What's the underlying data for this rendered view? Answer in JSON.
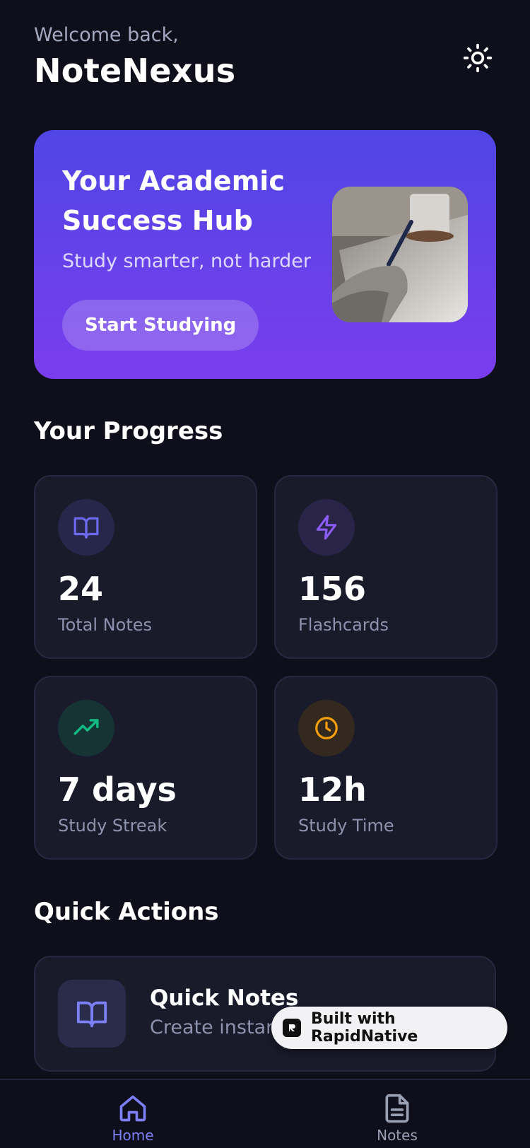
{
  "header": {
    "welcome": "Welcome back,",
    "title": "NoteNexus",
    "theme_icon": "sun-icon"
  },
  "hero": {
    "title": "Your Academic Success Hub",
    "subtitle": "Study smarter, not harder",
    "button_label": "Start Studying",
    "image": "study-photo"
  },
  "progress": {
    "title": "Your Progress",
    "stats": [
      {
        "value": "24",
        "label": "Total Notes",
        "icon": "book-icon",
        "color": "#6d6af0"
      },
      {
        "value": "156",
        "label": "Flashcards",
        "icon": "lightning-icon",
        "color": "#8b5cf6"
      },
      {
        "value": "7 days",
        "label": "Study Streak",
        "icon": "trending-up-icon",
        "color": "#10b981"
      },
      {
        "value": "12h",
        "label": "Study Time",
        "icon": "clock-icon",
        "color": "#f59e0b"
      }
    ]
  },
  "quick_actions": {
    "title": "Quick Actions",
    "items": [
      {
        "title": "Quick Notes",
        "subtitle": "Create instan",
        "icon": "book-icon"
      }
    ]
  },
  "badge": {
    "label": "Built with RapidNative"
  },
  "nav": {
    "items": [
      {
        "label": "Home",
        "icon": "home-icon",
        "active": true
      },
      {
        "label": "Notes",
        "icon": "document-icon",
        "active": false
      }
    ],
    "active_color": "#7c7ff5",
    "inactive_color": "#9aa0b4"
  },
  "colors": {
    "background": "#0e0f1a",
    "card": "#191a2a",
    "hero_start": "#5046e5",
    "hero_end": "#7a3ded"
  }
}
